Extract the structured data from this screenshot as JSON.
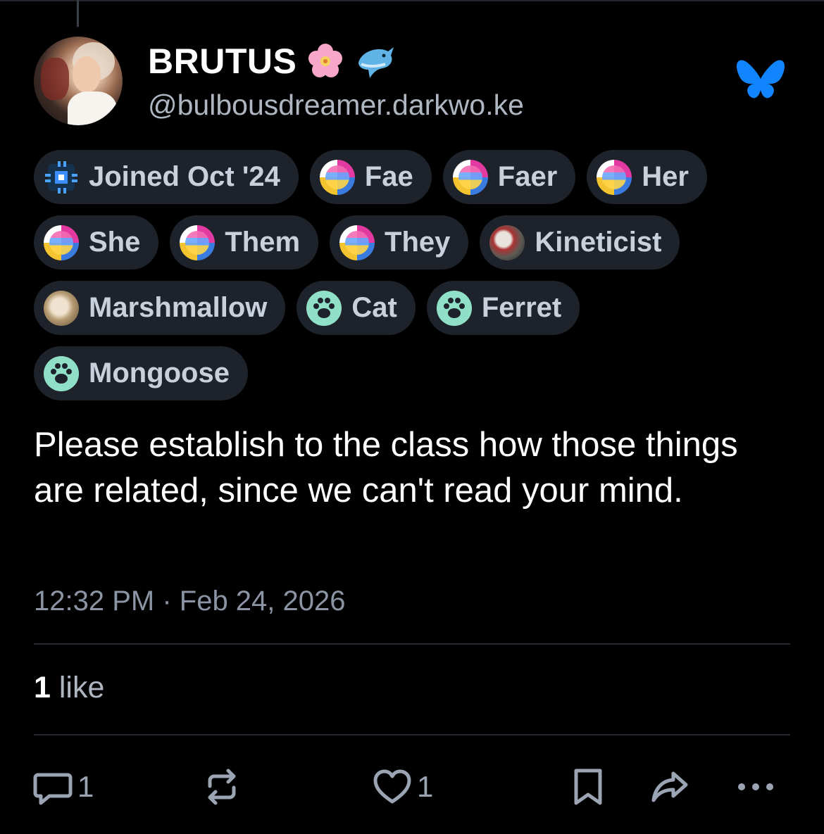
{
  "profile": {
    "display_name": "BRUTUS",
    "handle": "@bulbousdreamer.darkwo.ke",
    "name_emojis": [
      "cherry-blossom-emoji",
      "dolphin-emoji"
    ]
  },
  "badges": [
    [
      {
        "icon": "joined-badge-icon",
        "label": "Joined Oct '24"
      },
      {
        "icon": "pronoun-flag-icon",
        "label": "Fae"
      },
      {
        "icon": "pronoun-flag-icon",
        "label": "Faer"
      },
      {
        "icon": "pronoun-flag-icon",
        "label": "Her"
      }
    ],
    [
      {
        "icon": "pronoun-flag-icon",
        "label": "She"
      },
      {
        "icon": "pronoun-flag-icon",
        "label": "Them"
      },
      {
        "icon": "pronoun-flag-icon",
        "label": "They"
      },
      {
        "icon": "kineticist-icon",
        "label": "Kineticist"
      }
    ],
    [
      {
        "icon": "marshmallow-icon",
        "label": "Marshmallow"
      },
      {
        "icon": "paw-icon",
        "label": "Cat"
      },
      {
        "icon": "paw-icon",
        "label": "Ferret"
      }
    ],
    [
      {
        "icon": "paw-icon",
        "label": "Mongoose"
      }
    ]
  ],
  "post": {
    "text": "Please establish to the class how those things are related, since we can't read your mind.",
    "timestamp": "12:32 PM · Feb 24, 2026"
  },
  "likes": {
    "count": "1",
    "label": "like"
  },
  "actions": {
    "reply_count": "1",
    "like_count": "1"
  },
  "colors": {
    "background": "#000000",
    "pill": "#1e232b",
    "muted_text": "#8a94a3",
    "bluesky_blue": "#1185fe"
  }
}
